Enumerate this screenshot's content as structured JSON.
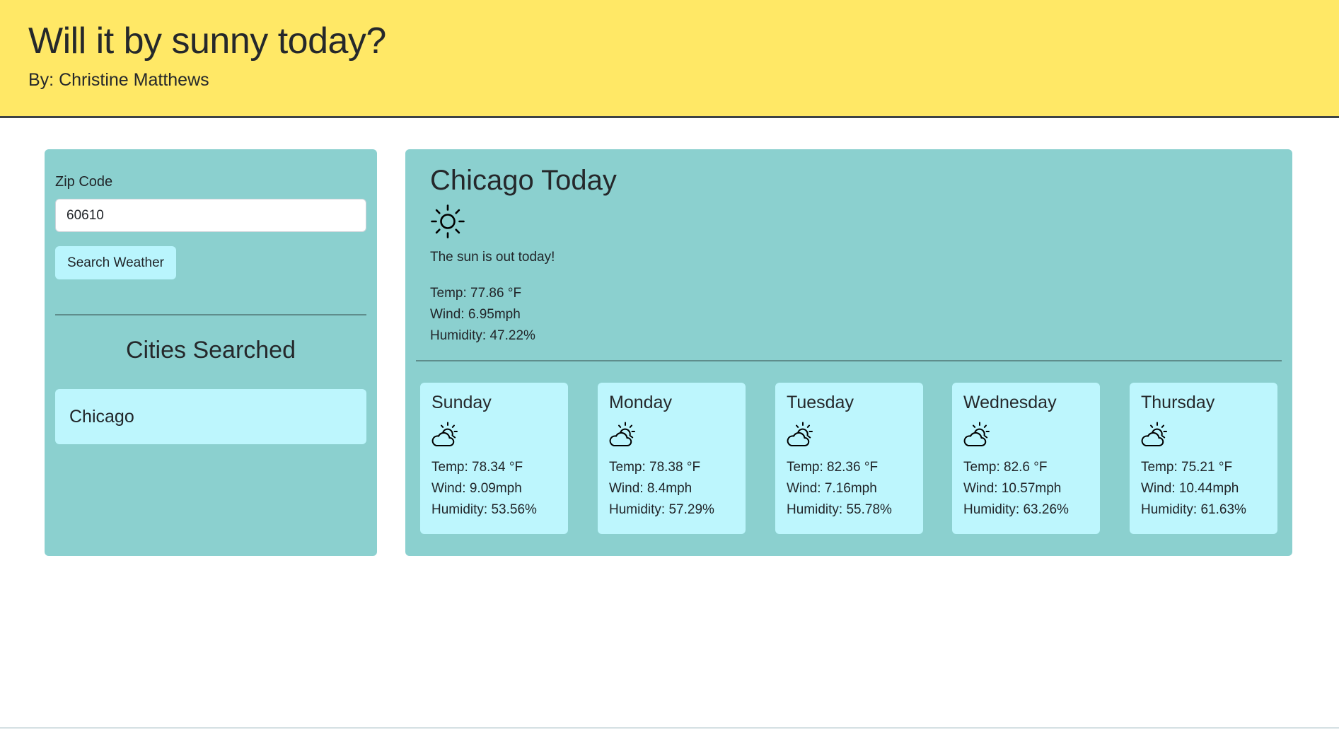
{
  "header": {
    "title": "Will it by sunny today?",
    "byline": "By: Christine Matthews",
    "background_color": "#ffe866"
  },
  "search": {
    "label": "Zip Code",
    "value": "60610",
    "button_label": "Search Weather"
  },
  "history": {
    "title": "Cities Searched",
    "cities": [
      "Chicago"
    ]
  },
  "today": {
    "title": "Chicago Today",
    "icon": "sun-icon",
    "description": "The sun is out today!",
    "temp": "Temp: 77.86 °F",
    "wind": "Wind: 6.95mph",
    "humidity": "Humidity: 47.22%"
  },
  "forecast": [
    {
      "day": "Sunday",
      "icon": "partly-cloudy-icon",
      "temp": "Temp: 78.34 °F",
      "wind": "Wind: 9.09mph",
      "humidity": "Humidity: 53.56%"
    },
    {
      "day": "Monday",
      "icon": "partly-cloudy-icon",
      "temp": "Temp: 78.38 °F",
      "wind": "Wind: 8.4mph",
      "humidity": "Humidity: 57.29%"
    },
    {
      "day": "Tuesday",
      "icon": "partly-cloudy-icon",
      "temp": "Temp: 82.36 °F",
      "wind": "Wind: 7.16mph",
      "humidity": "Humidity: 55.78%"
    },
    {
      "day": "Wednesday",
      "icon": "partly-cloudy-icon",
      "temp": "Temp: 82.6 °F",
      "wind": "Wind: 10.57mph",
      "humidity": "Humidity: 63.26%"
    },
    {
      "day": "Thursday",
      "icon": "partly-cloudy-icon",
      "temp": "Temp: 75.21 °F",
      "wind": "Wind: 10.44mph",
      "humidity": "Humidity: 61.63%"
    }
  ],
  "colors": {
    "panel": "#8bd0cf",
    "card": "#bdf6fd",
    "divider": "#5f8d8c"
  }
}
